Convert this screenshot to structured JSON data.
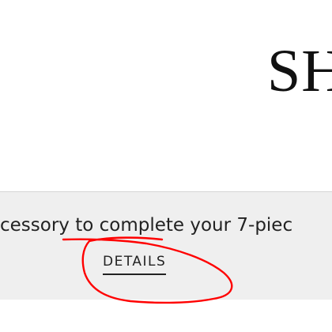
{
  "header": {
    "logo_text": "SH"
  },
  "promo": {
    "text": "cessory to complete your 7-piec",
    "details_label": "DETAILS"
  },
  "colors": {
    "banner_background": "#efefef",
    "annotation_stroke": "#ff0000"
  }
}
